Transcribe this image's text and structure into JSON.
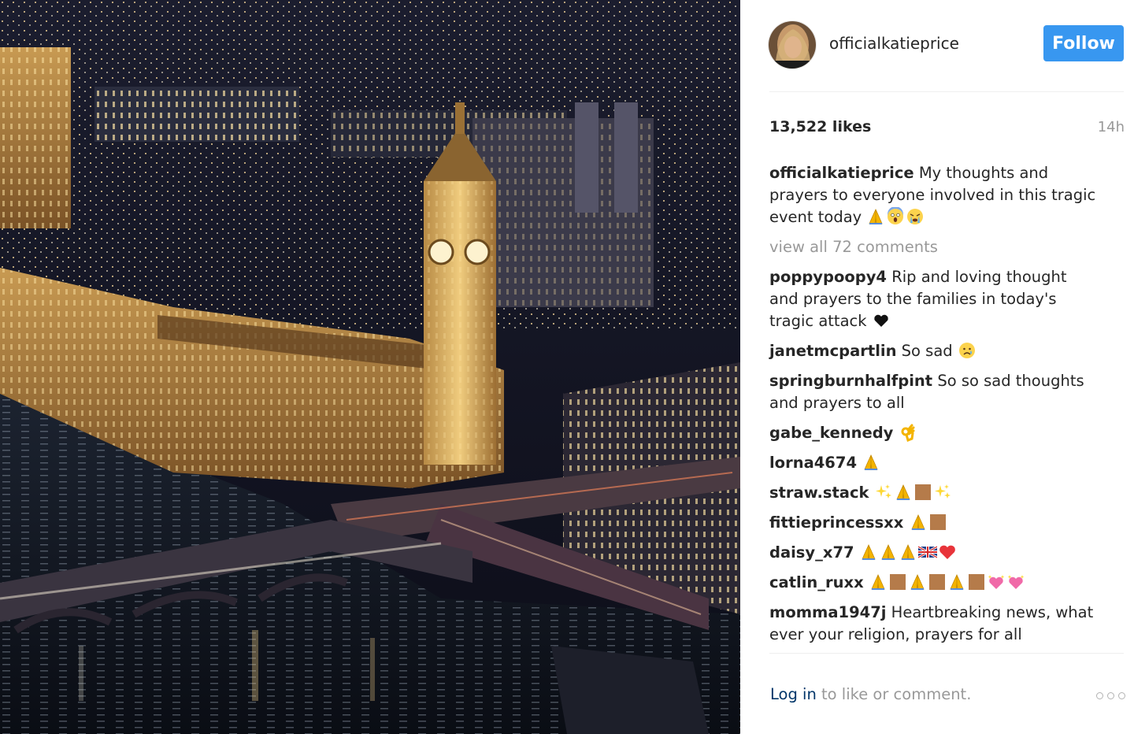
{
  "post": {
    "username": "officialkatieprice",
    "follow_label": "Follow",
    "likes": "13,522 likes",
    "time": "14h",
    "caption": "My thoughts and prayers to everyone involved in this tragic event today",
    "caption_emojis": [
      "praying-hands",
      "screaming-face",
      "crying-face"
    ],
    "view_all": "view all 72 comments"
  },
  "comments": [
    {
      "user": "poppypoopy4",
      "text": "Rip and loving thought and prayers to the families in today's tragic attack",
      "emojis": [
        "black-heart"
      ]
    },
    {
      "user": "janetmcpartlin",
      "text": "So sad",
      "emojis": [
        "sad-face"
      ]
    },
    {
      "user": "springburnhalfpint",
      "text": "So so sad thoughts and prayers to all",
      "emojis": []
    },
    {
      "user": "gabe_kennedy",
      "text": "",
      "emojis": [
        "ok-hand"
      ]
    },
    {
      "user": "lorna4674",
      "text": "",
      "emojis": [
        "praying-hands"
      ]
    },
    {
      "user": "straw.stack",
      "text": "",
      "emojis": [
        "sparkles",
        "praying-hands",
        "skin-tone",
        "sparkles"
      ]
    },
    {
      "user": "fittieprincessxx",
      "text": "",
      "emojis": [
        "praying-hands",
        "skin-tone"
      ]
    },
    {
      "user": "daisy_x77",
      "text": "",
      "emojis": [
        "praying-hands",
        "praying-hands",
        "praying-hands",
        "uk-flag",
        "red-heart"
      ]
    },
    {
      "user": "catlin_ruxx",
      "text": "",
      "emojis": [
        "praying-hands",
        "skin-tone",
        "praying-hands",
        "skin-tone",
        "praying-hands",
        "skin-tone",
        "sparkling-heart",
        "sparkling-heart"
      ]
    },
    {
      "user": "momma1947j",
      "text": "Heartbreaking news, what ever your religion, prayers for all",
      "emojis": []
    }
  ],
  "footer": {
    "login_link": "Log in",
    "login_rest": " to like or comment."
  },
  "colors": {
    "follow_bg": "#3897f0",
    "muted": "#999999",
    "link": "#003569",
    "text": "#262626"
  }
}
